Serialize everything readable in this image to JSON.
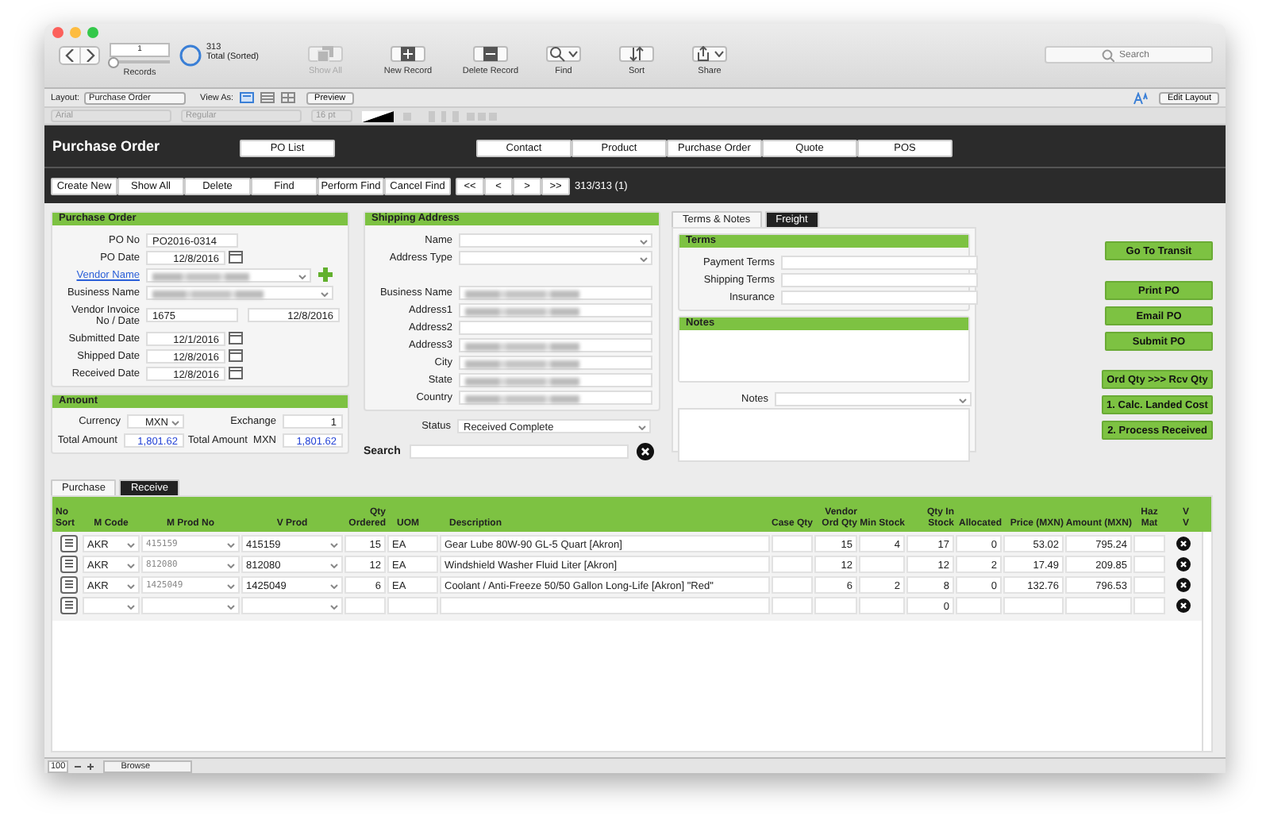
{
  "toolbar": {
    "nav_buttons": [
      {
        "kind": "back"
      },
      {
        "kind": "forward"
      }
    ],
    "record_number": "1",
    "record_slider": {
      "level": 0
    },
    "found_count": "313",
    "found_status": "Total (Sorted)",
    "records_label": "Records",
    "tools": [
      {
        "label": "Show All",
        "kind": "stack",
        "disabled": true
      },
      {
        "label": "New Record",
        "kind": "plus",
        "disabled": false
      },
      {
        "label": "Delete Record",
        "kind": "minus",
        "disabled": false
      },
      {
        "label": "Find",
        "kind": "search",
        "disabled": false
      },
      {
        "label": "Sort",
        "kind": "sort",
        "disabled": false
      },
      {
        "label": "Share",
        "kind": "share",
        "disabled": false
      }
    ],
    "search_placeholder": "Search"
  },
  "layout_bar": {
    "layout_label": "Layout:",
    "layout_value": "Purchase Order",
    "view_as_label": "View As:",
    "view_modes": [
      {
        "kind": "form",
        "selected": true
      },
      {
        "kind": "list",
        "selected": false
      },
      {
        "kind": "table",
        "selected": false
      }
    ],
    "preview": "Preview",
    "edit_layout": "Edit Layout"
  },
  "format_bar": {
    "font": "Arial",
    "style": "Regular",
    "size": "16 pt"
  },
  "header": {
    "title": "Purchase Order",
    "po_list": "PO List",
    "nav": [
      "Contact",
      "Product",
      "Purchase Order",
      "Quote",
      "POS"
    ]
  },
  "action_bar": {
    "buttons": [
      "Create New",
      "Show All",
      "Delete",
      "Find",
      "Perform Find",
      "Cancel Find"
    ],
    "record_nav": [
      "<<",
      "<",
      ">",
      ">>"
    ],
    "record_status": "313/313 (1)"
  },
  "purchase_order": {
    "title": "Purchase Order",
    "fields": [
      {
        "label": "PO No",
        "kind": "text",
        "value": "PO2016-0314"
      },
      {
        "label": "PO Date",
        "kind": "date",
        "value": "12/8/2016"
      },
      {
        "label": "Vendor Name",
        "kind": "link",
        "blurred": true
      },
      {
        "label": "Business Name",
        "kind": "dropdown",
        "blurred": true
      },
      {
        "label": "Vendor Invoice No / Date",
        "kind": "pair",
        "value": "1675",
        "date": "12/8/2016"
      },
      {
        "label": "Submitted Date",
        "kind": "date",
        "value": "12/1/2016"
      },
      {
        "label": "Shipped Date",
        "kind": "date",
        "value": "12/8/2016"
      },
      {
        "label": "Received Date",
        "kind": "date",
        "value": "12/8/2016"
      }
    ]
  },
  "amount": {
    "title": "Amount",
    "fields": [
      {
        "label": "Currency",
        "kind": "dropdown",
        "value": "MXN"
      },
      {
        "label": "Exchange",
        "kind": "number",
        "value": "1"
      },
      {
        "label": "Total Amount",
        "kind": "total",
        "value": "1,801.62"
      },
      {
        "label": "Total Amount  MXN",
        "kind": "total",
        "value": "1,801.62"
      }
    ]
  },
  "shipping_address": {
    "title": "Shipping Address",
    "selectors": [
      {
        "label": "Name"
      },
      {
        "label": "Address Type"
      }
    ],
    "fields": [
      {
        "label": "Business Name",
        "blurred": true
      },
      {
        "label": "Address1",
        "blurred": true
      },
      {
        "label": "Address2",
        "blurred": false
      },
      {
        "label": "Address3",
        "blurred": true
      },
      {
        "label": "City",
        "blurred": true
      },
      {
        "label": "State",
        "blurred": true
      },
      {
        "label": "Country",
        "blurred": true
      }
    ],
    "status_label": "Status",
    "status_value": "Received Complete",
    "search_label": "Search"
  },
  "detail_tabs": [
    {
      "label": "Terms & Notes",
      "selected": true
    },
    {
      "label": "Freight",
      "selected": false
    }
  ],
  "terms": {
    "title": "Terms",
    "fields": [
      "Payment Terms",
      "Shipping Terms",
      "Insurance"
    ]
  },
  "notes": {
    "title": "Notes",
    "dropdown_label": "Notes"
  },
  "side_button_groups": [
    [
      "Go To Transit"
    ],
    [
      "Print PO",
      "Email PO",
      "Submit PO"
    ],
    [
      "Ord Qty >>> Rcv Qty",
      "1. Calc. Landed Cost",
      "2. Process Received"
    ]
  ],
  "line_tabs": [
    {
      "label": "Purchase",
      "selected": true
    },
    {
      "label": "Receive",
      "selected": false
    }
  ],
  "table": {
    "columns": [
      "No Sort",
      "M Code",
      "M Prod No",
      "V Prod",
      "Qty Ordered",
      "UOM",
      "Description",
      "Case Qty",
      "Vendor Ord Qty",
      "Min Stock",
      "Qty In Stock",
      "Allocated",
      "Price (MXN)",
      "Amount (MXN)",
      "Haz Mat",
      "V V"
    ],
    "rows": [
      {
        "m_code": "AKR",
        "m_prod_no": "415159",
        "v_prod": "415159",
        "qty_ordered": "15",
        "uom": "EA",
        "description": "Gear Lube 80W-90 GL-5 Quart [Akron]",
        "vendor_ord_qty": "15",
        "min_stock": "4",
        "qty_in_stock": "17",
        "allocated": "0",
        "price": "53.02",
        "amount": "795.24"
      },
      {
        "m_code": "AKR",
        "m_prod_no": "812080",
        "v_prod": "812080",
        "qty_ordered": "12",
        "uom": "EA",
        "description": "Windshield Washer Fluid Liter [Akron]",
        "vendor_ord_qty": "12",
        "qty_in_stock": "12",
        "allocated": "2",
        "price": "17.49",
        "amount": "209.85"
      },
      {
        "m_code": "AKR",
        "m_prod_no": "1425049",
        "v_prod": "1425049",
        "qty_ordered": "6",
        "uom": "EA",
        "description": "Coolant / Anti-Freeze 50/50 Gallon Long-Life [Akron] \"Red\"",
        "vendor_ord_qty": "6",
        "min_stock": "2",
        "qty_in_stock": "8",
        "allocated": "0",
        "price": "132.76",
        "amount": "796.53"
      },
      {
        "qty_in_stock": "0"
      }
    ]
  },
  "status_bar": {
    "zoom": "100",
    "mode": "Browse"
  }
}
